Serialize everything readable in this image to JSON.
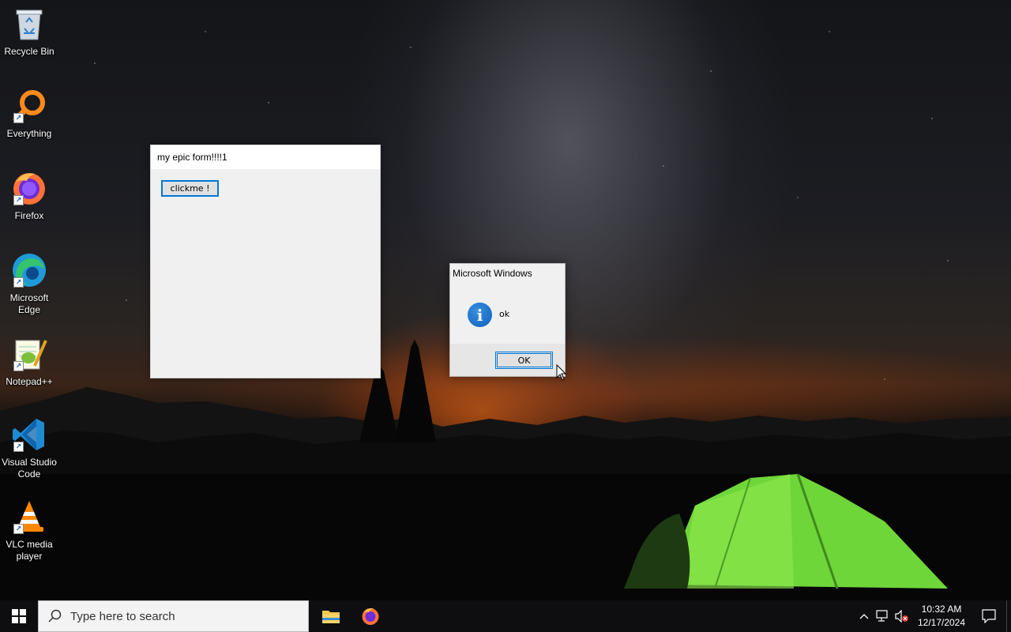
{
  "desktop": {
    "icons": [
      {
        "label": "Recycle Bin",
        "icon": "recycle-bin-icon"
      },
      {
        "label": "Everything",
        "icon": "everything-search-icon"
      },
      {
        "label": "Firefox",
        "icon": "firefox-icon"
      },
      {
        "label": "Microsoft\nEdge",
        "icon": "edge-icon"
      },
      {
        "label": "Notepad++",
        "icon": "notepadpp-icon"
      },
      {
        "label": "Visual Studio\nCode",
        "icon": "vscode-icon"
      },
      {
        "label": "VLC media\nplayer",
        "icon": "vlc-icon"
      }
    ]
  },
  "form_window": {
    "title": "my epic form!!!!1",
    "button_label": "clickme !"
  },
  "message_box": {
    "title": "Microsoft Windows",
    "icon": "information-icon",
    "message": "ok",
    "ok_label": "OK"
  },
  "taskbar": {
    "search_placeholder": "Type here to search",
    "pinned_apps": [
      "file-explorer-icon",
      "firefox-icon"
    ],
    "clock_time": "10:32 AM",
    "clock_date": "12/17/2024"
  },
  "colors": {
    "accent": "#0078d7",
    "taskbar": "#0e0e10",
    "dialog_bg": "#f0f0f0"
  }
}
